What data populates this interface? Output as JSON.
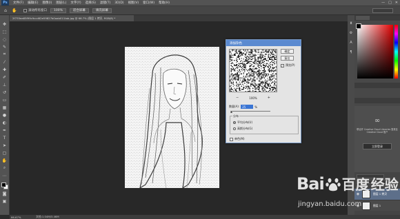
{
  "app": {
    "logo": "Ps",
    "window_controls": [
      "—",
      "□",
      "✕"
    ]
  },
  "menu": [
    "文件(F)",
    "编辑(E)",
    "图像(I)",
    "图层(L)",
    "文字(Y)",
    "选择(S)",
    "滤镜(T)",
    "3D(D)",
    "视图(V)",
    "窗口(W)",
    "帮助(H)"
  ],
  "options_bar": {
    "scroll_all_label": "滚动所有窗口",
    "buttons": [
      "100%",
      "适合屏幕",
      "填充屏幕"
    ]
  },
  "document": {
    "tab_title": "2f735ea65f99c9ccd62e59827b0aab011tab.jpg @ 66.7% (图层 1 拷贝, RGB/8) *",
    "zoom": "66.67%",
    "doc_size": "文档:1.04M/3.46M"
  },
  "dialog": {
    "title": "添加杂色",
    "ok": "确定",
    "reset": "复位",
    "preview_label": "预览(P)",
    "preview_checked": true,
    "zoom_value": "100%",
    "zoom_out": "−",
    "zoom_in": "+",
    "amount_label": "数量(A):",
    "amount_value": "25",
    "amount_unit": "%",
    "distribution_label": "分布",
    "uniform_label": "平均分布(U)",
    "gaussian_label": "高斯分布(G)",
    "selected_distribution": "uniform",
    "monochrome_label": "单色(M)",
    "monochrome_checked": false
  },
  "panels": {
    "creative_cloud": {
      "text": "联合开 Creative Cloud Libraries 登录至 Creative Cloud 账户",
      "button": "立即登录"
    },
    "layers": {
      "active_layer": "图层 1 拷贝",
      "layer_2": "图层 1"
    },
    "foreground_color": "#000000",
    "background_color": "#ffffff"
  },
  "watermark": {
    "bai": "Bai",
    "du": "百度",
    "suffix": "经验",
    "url": "jingyan.baidu.com"
  }
}
